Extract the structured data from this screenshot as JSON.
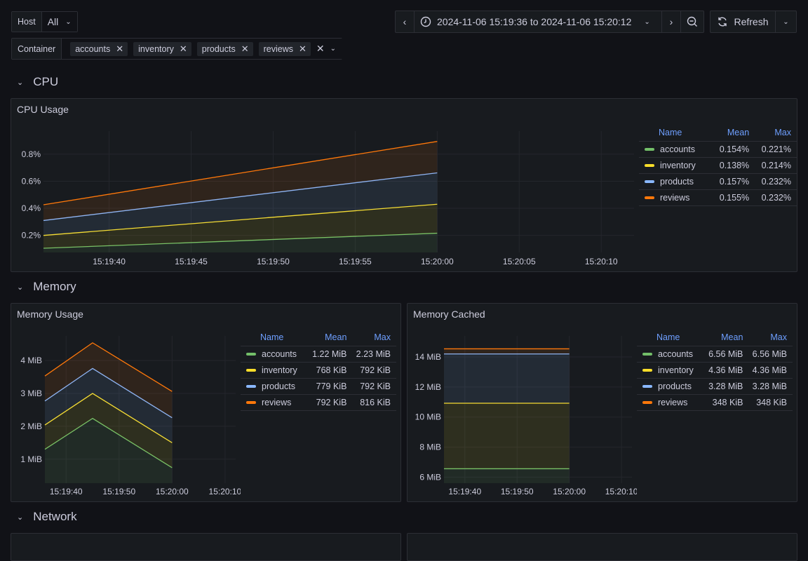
{
  "variables": {
    "host": {
      "label": "Host",
      "value": "All"
    },
    "container": {
      "label": "Container",
      "values": [
        "accounts",
        "inventory",
        "products",
        "reviews"
      ]
    }
  },
  "toolbar": {
    "time_range": "2024-11-06 15:19:36 to 2024-11-06 15:20:12",
    "refresh_label": "Refresh"
  },
  "icons": {
    "prev": "chevron-left-icon",
    "clock": "clock-icon",
    "next": "chevron-right-icon",
    "zoom_out": "zoom-out-icon",
    "refresh": "refresh-icon"
  },
  "rows": [
    {
      "title": "CPU"
    },
    {
      "title": "Memory"
    },
    {
      "title": "Network"
    }
  ],
  "colors": {
    "accounts": "#73bf69",
    "inventory": "#fade2a",
    "products": "#8ab8ff",
    "reviews": "#ff780a",
    "legend_header": "#6e9fff"
  },
  "legend_headers": {
    "name": "Name",
    "mean": "Mean",
    "max": "Max"
  },
  "panels": {
    "cpu": {
      "title": "CPU Usage",
      "legend": [
        {
          "name": "accounts",
          "mean": "0.154%",
          "max": "0.221%"
        },
        {
          "name": "inventory",
          "mean": "0.138%",
          "max": "0.214%"
        },
        {
          "name": "products",
          "mean": "0.157%",
          "max": "0.232%"
        },
        {
          "name": "reviews",
          "mean": "0.155%",
          "max": "0.232%"
        }
      ]
    },
    "mem_usage": {
      "title": "Memory Usage",
      "legend": [
        {
          "name": "accounts",
          "mean": "1.22 MiB",
          "max": "2.23 MiB"
        },
        {
          "name": "inventory",
          "mean": "768 KiB",
          "max": "792 KiB"
        },
        {
          "name": "products",
          "mean": "779 KiB",
          "max": "792 KiB"
        },
        {
          "name": "reviews",
          "mean": "792 KiB",
          "max": "816 KiB"
        }
      ]
    },
    "mem_cached": {
      "title": "Memory Cached",
      "legend": [
        {
          "name": "accounts",
          "mean": "6.56 MiB",
          "max": "6.56 MiB"
        },
        {
          "name": "inventory",
          "mean": "4.36 MiB",
          "max": "4.36 MiB"
        },
        {
          "name": "products",
          "mean": "3.28 MiB",
          "max": "3.28 MiB"
        },
        {
          "name": "reviews",
          "mean": "348 KiB",
          "max": "348 KiB"
        }
      ]
    }
  },
  "chart_data": [
    {
      "id": "cpu",
      "type": "area",
      "stacked": true,
      "title": "CPU Usage",
      "x_unit": "seconds since 15:19:36",
      "x": [
        0,
        24
      ],
      "xlim": [
        0,
        36
      ],
      "x_ticks": [
        {
          "v": 4,
          "label": "15:19:40"
        },
        {
          "v": 9,
          "label": "15:19:45"
        },
        {
          "v": 14,
          "label": "15:19:50"
        },
        {
          "v": 19,
          "label": "15:19:55"
        },
        {
          "v": 24,
          "label": "15:20:00"
        },
        {
          "v": 29,
          "label": "15:20:05"
        },
        {
          "v": 34,
          "label": "15:20:10"
        }
      ],
      "ylim": [
        0.074,
        0.97
      ],
      "y_ticks": [
        {
          "v": 0.2,
          "label": "0.2%"
        },
        {
          "v": 0.4,
          "label": "0.4%"
        },
        {
          "v": 0.6,
          "label": "0.6%"
        },
        {
          "v": 0.8,
          "label": "0.8%"
        }
      ],
      "series": [
        {
          "name": "accounts",
          "values": [
            0.105,
            0.216
          ]
        },
        {
          "name": "inventory",
          "values": [
            0.095,
            0.214
          ]
        },
        {
          "name": "products",
          "values": [
            0.11,
            0.232
          ]
        },
        {
          "name": "reviews",
          "values": [
            0.116,
            0.232
          ]
        }
      ]
    },
    {
      "id": "mem_usage",
      "type": "area",
      "stacked": true,
      "title": "Memory Usage",
      "x_unit": "seconds since 15:19:36",
      "x": [
        0,
        9,
        24
      ],
      "xlim": [
        0,
        36
      ],
      "x_ticks": [
        {
          "v": 4,
          "label": "15:19:40"
        },
        {
          "v": 14,
          "label": "15:19:50"
        },
        {
          "v": 24,
          "label": "15:20:00"
        },
        {
          "v": 34,
          "label": "15:20:10"
        }
      ],
      "ylim": [
        0.27,
        4.75
      ],
      "y_ticks": [
        {
          "v": 1,
          "label": "1 MiB"
        },
        {
          "v": 2,
          "label": "2 MiB"
        },
        {
          "v": 3,
          "label": "3 MiB"
        },
        {
          "v": 4,
          "label": "4 MiB"
        }
      ],
      "series": [
        {
          "name": "accounts",
          "values": [
            1.3,
            2.24,
            0.74
          ]
        },
        {
          "name": "inventory",
          "values": [
            0.74,
            0.76,
            0.76
          ]
        },
        {
          "name": "products",
          "values": [
            0.73,
            0.76,
            0.76
          ]
        },
        {
          "name": "reviews",
          "values": [
            0.76,
            0.78,
            0.8
          ]
        }
      ]
    },
    {
      "id": "mem_cached",
      "type": "area",
      "stacked": true,
      "title": "Memory Cached",
      "x_unit": "seconds since 15:19:36",
      "x": [
        0,
        24
      ],
      "xlim": [
        0,
        36
      ],
      "x_ticks": [
        {
          "v": 4,
          "label": "15:19:40"
        },
        {
          "v": 14,
          "label": "15:19:50"
        },
        {
          "v": 24,
          "label": "15:20:00"
        },
        {
          "v": 34,
          "label": "15:20:10"
        }
      ],
      "ylim": [
        5.6,
        15.4
      ],
      "y_ticks": [
        {
          "v": 6,
          "label": "6 MiB"
        },
        {
          "v": 8,
          "label": "8 MiB"
        },
        {
          "v": 10,
          "label": "10 MiB"
        },
        {
          "v": 12,
          "label": "12 MiB"
        },
        {
          "v": 14,
          "label": "14 MiB"
        }
      ],
      "series": [
        {
          "name": "accounts",
          "values": [
            6.56,
            6.56
          ]
        },
        {
          "name": "inventory",
          "values": [
            4.36,
            4.36
          ]
        },
        {
          "name": "products",
          "values": [
            3.28,
            3.28
          ]
        },
        {
          "name": "reviews",
          "values": [
            0.34,
            0.34
          ]
        }
      ]
    }
  ]
}
